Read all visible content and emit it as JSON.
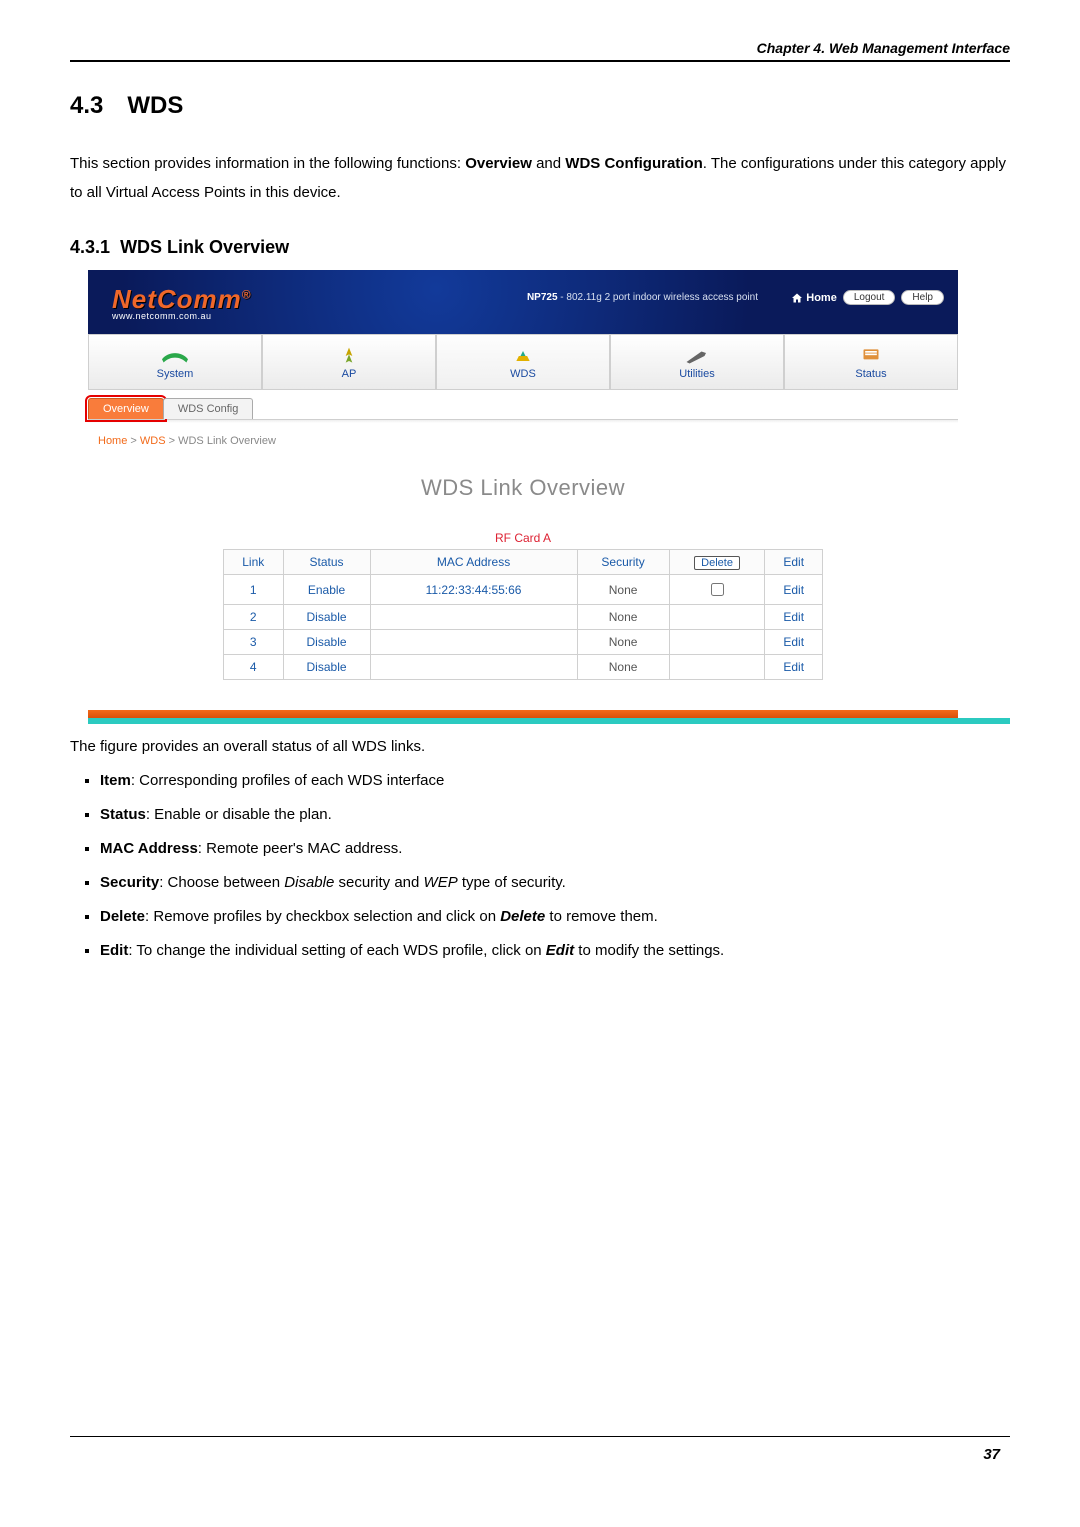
{
  "chapter_header": "Chapter 4. Web Management Interface",
  "section": {
    "number": "4.3",
    "title": "WDS"
  },
  "intro": {
    "pre": "This section provides information in the following functions: ",
    "b1": "Overview",
    "mid": " and ",
    "b2": "WDS Configuration",
    "post": ". The configurations under this category apply to all Virtual Access Points in this device."
  },
  "subsection": {
    "number": "4.3.1",
    "title": "WDS Link Overview"
  },
  "screenshot": {
    "brand": {
      "name": "NetComm",
      "reg": "®",
      "url": "www.netcomm.com.au"
    },
    "product": {
      "model": "NP725",
      "desc": " - 802.11g 2 port indoor wireless access point"
    },
    "header_buttons": {
      "home": "Home",
      "logout": "Logout",
      "help": "Help"
    },
    "nav": {
      "items": [
        {
          "label": "System"
        },
        {
          "label": "AP"
        },
        {
          "label": "WDS"
        },
        {
          "label": "Utilities"
        },
        {
          "label": "Status"
        }
      ]
    },
    "subtabs": {
      "overview": "Overview",
      "config": "WDS Config"
    },
    "breadcrumb": {
      "home": "Home",
      "sep": " > ",
      "wds": "WDS",
      "current": "WDS Link Overview"
    },
    "panel_title": "WDS Link Overview",
    "rf_title": "RF Card A",
    "table_headers": {
      "link": "Link",
      "status": "Status",
      "mac": "MAC Address",
      "security": "Security",
      "delete": "Delete",
      "edit": "Edit"
    },
    "rows": [
      {
        "link": "1",
        "status": "Enable",
        "mac": "11:22:33:44:55:66",
        "security": "None",
        "deletable": true,
        "edit": "Edit"
      },
      {
        "link": "2",
        "status": "Disable",
        "mac": "",
        "security": "None",
        "deletable": false,
        "edit": "Edit"
      },
      {
        "link": "3",
        "status": "Disable",
        "mac": "",
        "security": "None",
        "deletable": false,
        "edit": "Edit"
      },
      {
        "link": "4",
        "status": "Disable",
        "mac": "",
        "security": "None",
        "deletable": false,
        "edit": "Edit"
      }
    ]
  },
  "figure_caption": "The figure provides an overall status of all WDS links.",
  "list": [
    {
      "term": "Item",
      "desc": ": Corresponding profiles of each WDS interface"
    },
    {
      "term": "Status",
      "desc": ": Enable or disable the plan."
    },
    {
      "term": "MAC Address",
      "desc": ": Remote peer's MAC address."
    },
    {
      "term": "Security",
      "pre": ": Choose between ",
      "i1": "Disable",
      "mid": " security and ",
      "i2": "WEP",
      "post": " type of security."
    },
    {
      "term": "Delete",
      "pre": ": Remove profiles by checkbox selection and click on ",
      "bi": "Delete",
      "post": " to remove them."
    },
    {
      "term": "Edit",
      "pre": ": To change the individual setting of each WDS profile, click on ",
      "bi": "Edit",
      "post": " to modify the settings."
    }
  ],
  "page_number": "37"
}
